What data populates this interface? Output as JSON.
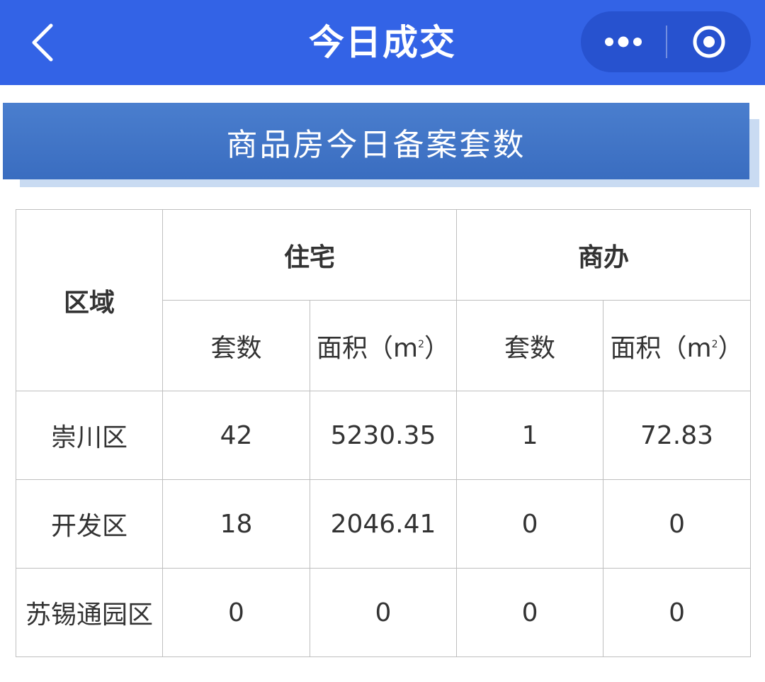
{
  "header": {
    "title": "今日成交",
    "back_icon": "chevron-left-icon",
    "more_icon": "more-dots-icon",
    "close_icon": "target-close-icon",
    "bg_color": "#3363e6"
  },
  "banner": {
    "title": "商品房今日备案套数",
    "bg_color": "#3d74c7"
  },
  "table": {
    "region_header": "区域",
    "group_headers": [
      "住宅",
      "商办"
    ],
    "sub_headers": {
      "count": "套数",
      "area_prefix": "面积（m",
      "area_sup": "2",
      "area_suffix": "）"
    },
    "rows": [
      {
        "region": "崇川区",
        "res_count": "42",
        "res_area": "5230.35",
        "com_count": "1",
        "com_area": "72.83"
      },
      {
        "region": "开发区",
        "res_count": "18",
        "res_area": "2046.41",
        "com_count": "0",
        "com_area": "0"
      },
      {
        "region": "苏锡通园区",
        "res_count": "0",
        "res_area": "0",
        "com_count": "0",
        "com_area": "0"
      }
    ]
  }
}
